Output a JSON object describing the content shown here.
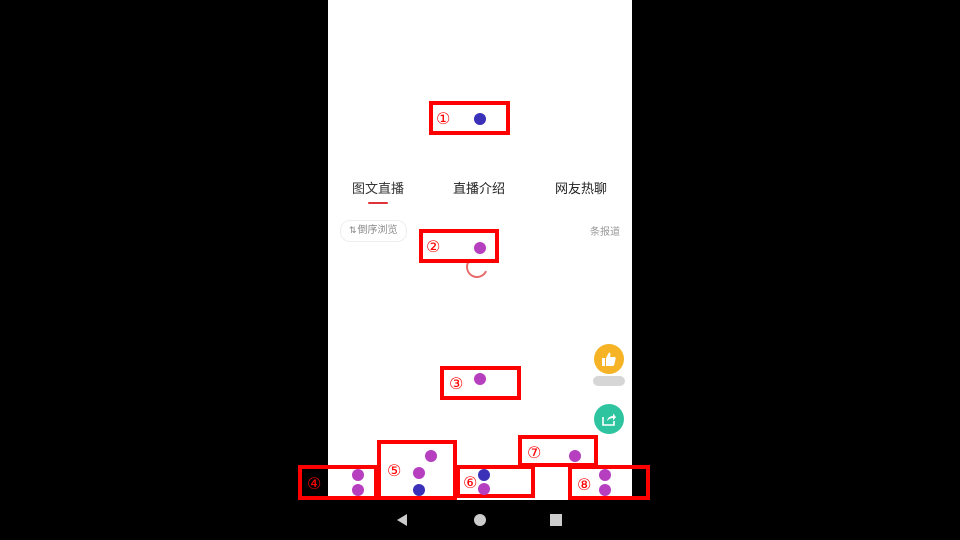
{
  "tabs": [
    {
      "label": "图文直播"
    },
    {
      "label": "直播介绍"
    },
    {
      "label": "网友热聊"
    }
  ],
  "toolbar": {
    "sort_label": "倒序浏览",
    "report_count": "条报道"
  },
  "annotations": [
    {
      "label": "①"
    },
    {
      "label": "②"
    },
    {
      "label": "③"
    },
    {
      "label": "④"
    },
    {
      "label": "⑤"
    },
    {
      "label": "⑥"
    },
    {
      "label": "⑦"
    },
    {
      "label": "⑧"
    }
  ],
  "colors": {
    "accent": "#e0323b",
    "like": "#f5b325",
    "share": "#2ec4a0",
    "annotation_box": "#ff0000",
    "dot_blue": "#3b30b8",
    "dot_purple": "#b53fbf"
  },
  "icons": {
    "like": "thumbs-up-icon",
    "share": "share-icon",
    "sort": "sort-arrows-icon",
    "back": "back-triangle-icon",
    "home": "home-circle-icon",
    "recents": "recents-square-icon"
  }
}
